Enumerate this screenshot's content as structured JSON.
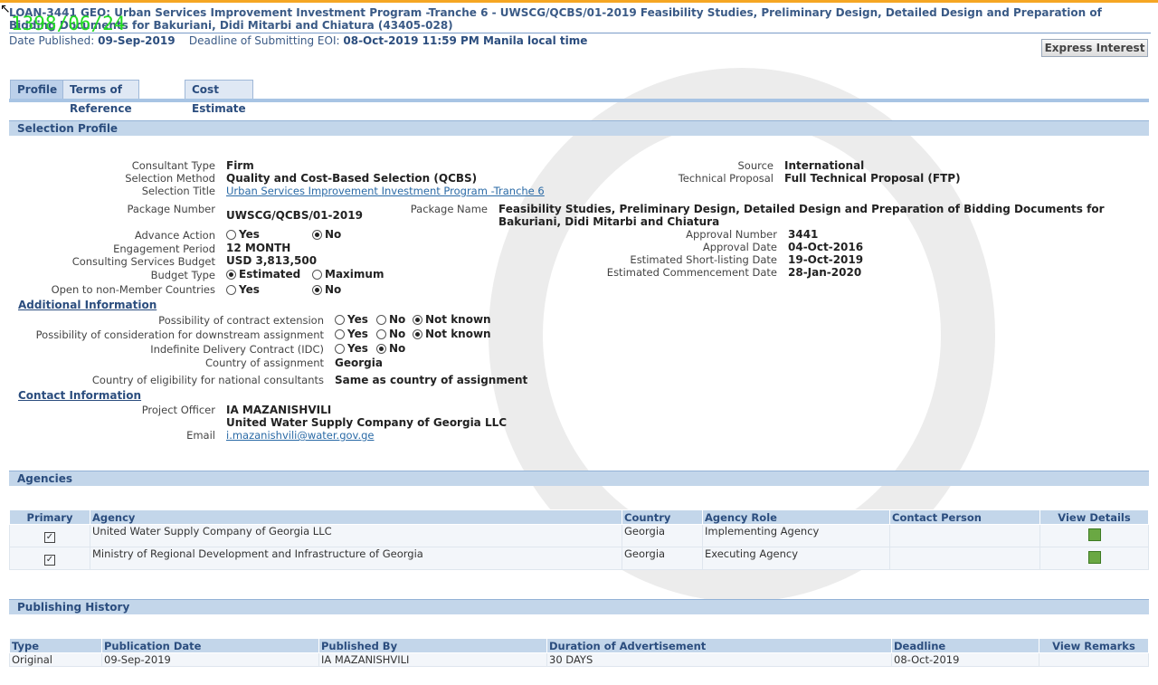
{
  "header": {
    "title": "LOAN-3441 GEO: Urban Services Improvement Investment Program -Tranche 6 - UWSCG/QCBS/01-2019 Feasibility Studies, Preliminary Design, Detailed Design and Preparation of Bidding Documents for Bakuriani, Didi Mitarbi and Chiatura (43405-028)",
    "stamp": "1398/06/24",
    "date_published_label": "Date Published:",
    "date_published": "09-Sep-2019",
    "deadline_label": "Deadline of Submitting EOI:",
    "deadline": "08-Oct-2019 11:59 PM Manila local time",
    "express_interest": "Express Interest"
  },
  "tabs": [
    "Profile",
    "Terms of Reference",
    "Cost Estimate"
  ],
  "selection_profile": {
    "heading": "Selection Profile",
    "consultant_type_label": "Consultant Type",
    "consultant_type": "Firm",
    "selection_method_label": "Selection Method",
    "selection_method": "Quality and Cost-Based Selection (QCBS)",
    "selection_title_label": "Selection Title",
    "selection_title": "Urban Services Improvement Investment Program -Tranche 6",
    "source_label": "Source",
    "source": "International",
    "technical_proposal_label": "Technical Proposal",
    "technical_proposal": "Full Technical Proposal (FTP)",
    "package_number_label": "Package Number",
    "package_number": "UWSCG/QCBS/01-2019",
    "package_name_label": "Package Name",
    "package_name": "Feasibility Studies, Preliminary Design, Detailed Design and Preparation of Bidding Documents for Bakuriani, Didi Mitarbi and Chiatura",
    "advance_action_label": "Advance Action",
    "yes": "Yes",
    "no": "No",
    "not_known": "Not known",
    "engagement_period_label": "Engagement Period",
    "engagement_period": "12 MONTH",
    "budget_label": "Consulting Services Budget",
    "budget": "USD 3,813,500",
    "budget_type_label": "Budget Type",
    "estimated": "Estimated",
    "maximum": "Maximum",
    "open_label": "Open to non-Member Countries",
    "approval_number_label": "Approval Number",
    "approval_number": "3441",
    "approval_date_label": "Approval Date",
    "approval_date": "04-Oct-2016",
    "shortlisting_label": "Estimated Short-listing Date",
    "shortlisting": "19-Oct-2019",
    "commencement_label": "Estimated Commencement Date",
    "commencement": "28-Jan-2020"
  },
  "additional": {
    "heading": "Additional Information",
    "extension_label": "Possibility of contract extension",
    "downstream_label": "Possibility of consideration for downstream assignment",
    "idc_label": "Indefinite Delivery Contract (IDC)",
    "country_label": "Country of assignment",
    "country": "Georgia",
    "eligibility_label": "Country of eligibility for national consultants",
    "eligibility": "Same as country of assignment"
  },
  "contact": {
    "heading": "Contact Information",
    "officer_label": "Project Officer",
    "officer": "IA MAZANISHVILI",
    "company": "United Water Supply Company of Georgia LLC",
    "email_label": "Email",
    "email": "i.mazanishvili@water.gov.ge"
  },
  "agencies": {
    "heading": "Agencies",
    "columns": [
      "Primary",
      "Agency",
      "Country",
      "Agency Role",
      "Contact Person",
      "View Details"
    ],
    "rows": [
      {
        "agency": "United Water Supply Company of Georgia LLC",
        "country": "Georgia",
        "role": "Implementing Agency"
      },
      {
        "agency": "Ministry of Regional Development and Infrastructure of Georgia",
        "country": "Georgia",
        "role": "Executing Agency"
      }
    ]
  },
  "history": {
    "heading": "Publishing History",
    "columns": [
      "Type",
      "Publication Date",
      "Published By",
      "Duration of Advertisement",
      "Deadline",
      "View Remarks"
    ],
    "row": {
      "type": "Original",
      "date": "09-Sep-2019",
      "by": "IA MAZANISHVILI",
      "duration": "30 DAYS",
      "deadline": "08-Oct-2019"
    }
  }
}
